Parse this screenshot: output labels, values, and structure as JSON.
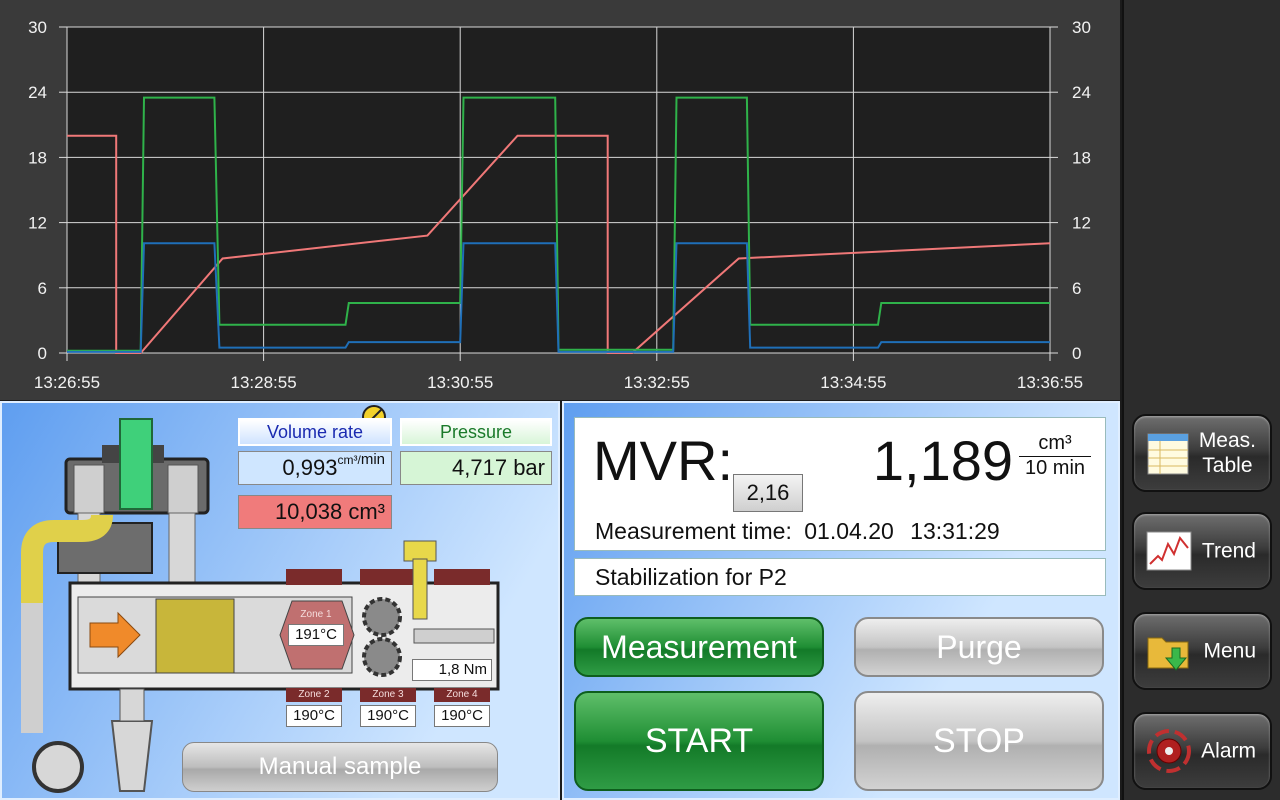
{
  "chart": {
    "y_ticks": [
      "30",
      "24",
      "18",
      "12",
      "6",
      "0"
    ],
    "x_ticks": [
      "13:26:55",
      "13:28:55",
      "13:30:55",
      "13:32:55",
      "13:34:55",
      "13:36:55"
    ],
    "colors": {
      "background": "#1f1f1f",
      "grid": "#d8d8d8",
      "red": "#f07878",
      "green": "#2fb24a",
      "blue": "#1f6fb8"
    }
  },
  "chart_data": {
    "type": "line",
    "y_range": [
      0,
      30
    ],
    "x_range": [
      "13:26:55",
      "13:36:55"
    ],
    "grid": true,
    "series": [
      {
        "color": "#f07878",
        "points": [
          [
            "13:26:55",
            20.0
          ],
          [
            "13:27:25",
            20.0
          ],
          [
            "13:27:25",
            0.0
          ],
          [
            "13:27:40",
            0.0
          ],
          [
            "13:28:30",
            8.7
          ],
          [
            "13:30:35",
            10.8
          ],
          [
            "13:31:30",
            20.0
          ],
          [
            "13:32:25",
            20.0
          ],
          [
            "13:32:25",
            0.0
          ],
          [
            "13:32:40",
            0.0
          ],
          [
            "13:33:45",
            8.7
          ],
          [
            "13:36:55",
            10.1
          ]
        ]
      },
      {
        "color": "#2fb24a",
        "points": [
          [
            "13:26:55",
            0.2
          ],
          [
            "13:27:40",
            0.2
          ],
          [
            "13:27:42",
            23.5
          ],
          [
            "13:28:25",
            23.5
          ],
          [
            "13:28:28",
            2.6
          ],
          [
            "13:29:45",
            2.6
          ],
          [
            "13:29:47",
            4.6
          ],
          [
            "13:30:55",
            4.6
          ],
          [
            "13:30:57",
            23.5
          ],
          [
            "13:31:53",
            23.5
          ],
          [
            "13:31:55",
            0.3
          ],
          [
            "13:33:05",
            0.3
          ],
          [
            "13:33:07",
            23.5
          ],
          [
            "13:33:50",
            23.5
          ],
          [
            "13:33:52",
            2.6
          ],
          [
            "13:35:10",
            2.6
          ],
          [
            "13:35:12",
            4.6
          ],
          [
            "13:36:55",
            4.6
          ]
        ]
      },
      {
        "color": "#1f6fb8",
        "points": [
          [
            "13:26:55",
            0.1
          ],
          [
            "13:27:40",
            0.1
          ],
          [
            "13:27:42",
            10.1
          ],
          [
            "13:28:25",
            10.1
          ],
          [
            "13:28:28",
            0.5
          ],
          [
            "13:29:45",
            0.5
          ],
          [
            "13:29:47",
            1.0
          ],
          [
            "13:30:55",
            1.0
          ],
          [
            "13:30:57",
            10.1
          ],
          [
            "13:31:53",
            10.1
          ],
          [
            "13:31:55",
            0.1
          ],
          [
            "13:33:05",
            0.1
          ],
          [
            "13:33:07",
            10.1
          ],
          [
            "13:33:50",
            10.1
          ],
          [
            "13:33:52",
            0.5
          ],
          [
            "13:35:10",
            0.5
          ],
          [
            "13:35:12",
            1.0
          ],
          [
            "13:36:55",
            1.0
          ]
        ]
      }
    ]
  },
  "machine": {
    "volume_rate_label": "Volume rate",
    "volume_rate_value": "0,993",
    "volume_rate_unit_num": "cm³",
    "volume_rate_unit_den": "min",
    "pressure_label": "Pressure",
    "pressure_value": "4,717 bar",
    "volume_value": "10,038 cm³",
    "zone1_label": "Zone 1",
    "zone1_value": "191°C",
    "zone2_label": "Zone 2",
    "zone2_value": "190°C",
    "zone3_label": "Zone 3",
    "zone3_value": "190°C",
    "zone4_label": "Zone 4",
    "zone4_value": "190°C",
    "torque_value": "1,8 Nm",
    "manual_sample_label": "Manual sample"
  },
  "result": {
    "mvr_label": "MVR:",
    "mvr_value": "1,189",
    "mvr_unit_num": "cm³",
    "mvr_unit_den": "10 min",
    "sub_value": "2,16",
    "measurement_time_label": "Measurement time:",
    "measurement_date": "01.04.20",
    "measurement_clock": "13:31:29",
    "status_text": "Stabilization for P2"
  },
  "buttons": {
    "measurement": "Measurement",
    "purge": "Purge",
    "start": "START",
    "stop": "STOP"
  },
  "sidebar": {
    "meas_table_line1": "Meas.",
    "meas_table_line2": "Table",
    "trend": "Trend",
    "menu": "Menu",
    "alarm": "Alarm"
  }
}
